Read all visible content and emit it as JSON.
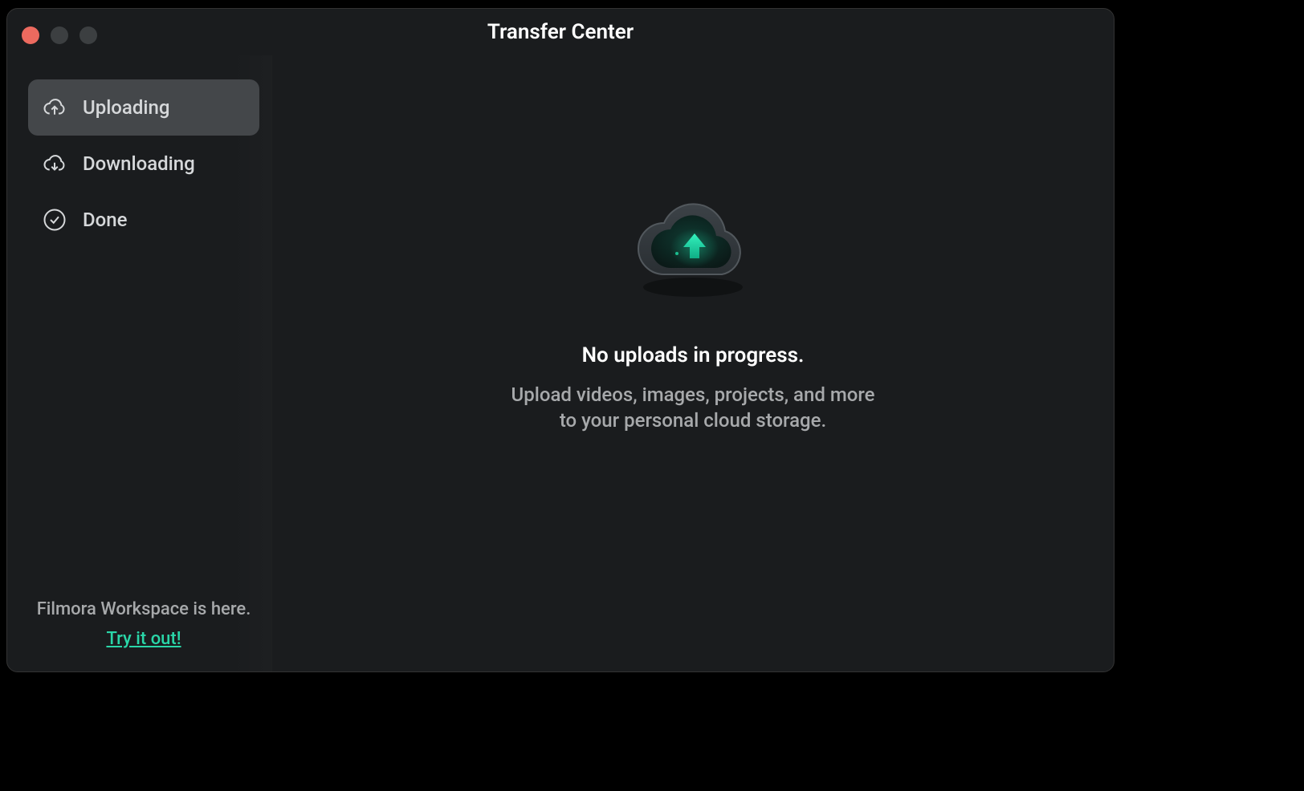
{
  "window": {
    "title": "Transfer Center"
  },
  "sidebar": {
    "items": [
      {
        "label": "Uploading"
      },
      {
        "label": "Downloading"
      },
      {
        "label": "Done"
      }
    ],
    "promo_text": "Filmora Workspace is here.",
    "promo_link": "Try it out!"
  },
  "main": {
    "empty_title": "No uploads in progress.",
    "empty_subtitle": "Upload videos, images, projects, and more\nto your personal cloud storage."
  },
  "colors": {
    "accent": "#2ad6a8",
    "window_bg": "#1a1c1e",
    "sidebar_active": "#44474a"
  }
}
